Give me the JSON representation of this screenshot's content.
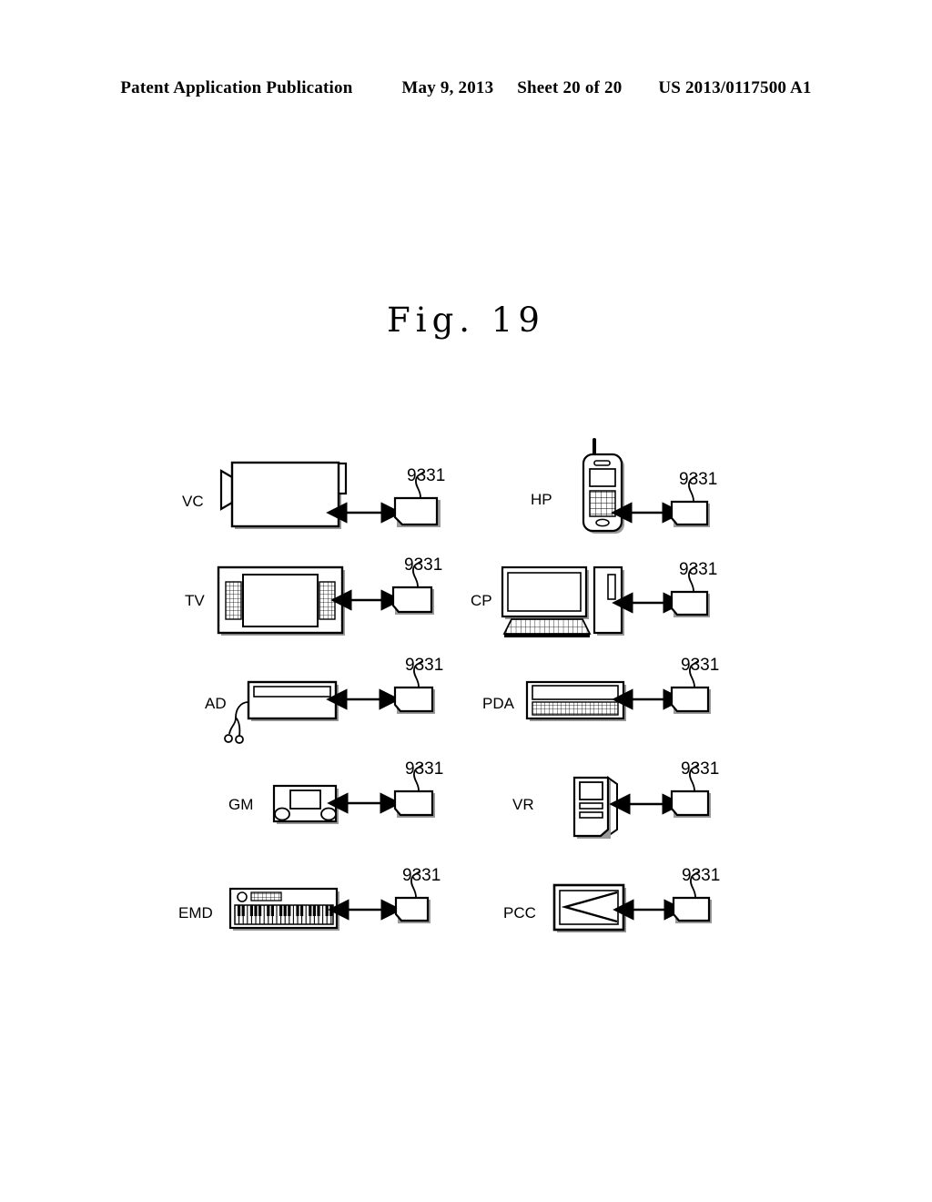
{
  "header": {
    "publication": "Patent Application Publication",
    "date": "May 9, 2013",
    "sheet": "Sheet 20 of 20",
    "number": "US 2013/0117500 A1"
  },
  "figure": {
    "title": "Fig.  19",
    "reference_numeral": "9331",
    "connector_symbol": "double-headed-arrow"
  },
  "colors": {
    "ink": "#000000",
    "paper": "#ffffff",
    "shadow": "#9a9a9a"
  },
  "devices": [
    {
      "id": "vc",
      "label": "VC",
      "name": "video-camera",
      "column": "left",
      "row": 1,
      "ref": "9331"
    },
    {
      "id": "hp",
      "label": "HP",
      "name": "handheld-phone",
      "column": "right",
      "row": 1,
      "ref": "9331"
    },
    {
      "id": "tv",
      "label": "TV",
      "name": "television",
      "column": "left",
      "row": 2,
      "ref": "9331"
    },
    {
      "id": "cp",
      "label": "CP",
      "name": "computer",
      "column": "right",
      "row": 2,
      "ref": "9331"
    },
    {
      "id": "ad",
      "label": "AD",
      "name": "audio-device",
      "column": "left",
      "row": 3,
      "ref": "9331"
    },
    {
      "id": "pda",
      "label": "PDA",
      "name": "personal-digital-assistant",
      "column": "right",
      "row": 3,
      "ref": "9331"
    },
    {
      "id": "gm",
      "label": "GM",
      "name": "game-machine",
      "column": "left",
      "row": 4,
      "ref": "9331"
    },
    {
      "id": "vr",
      "label": "VR",
      "name": "video-recorder",
      "column": "right",
      "row": 4,
      "ref": "9331"
    },
    {
      "id": "emd",
      "label": "EMD",
      "name": "electronic-musical-device",
      "column": "left",
      "row": 5,
      "ref": "9331"
    },
    {
      "id": "pcc",
      "label": "PCC",
      "name": "pc-card",
      "column": "right",
      "row": 5,
      "ref": "9331"
    }
  ]
}
